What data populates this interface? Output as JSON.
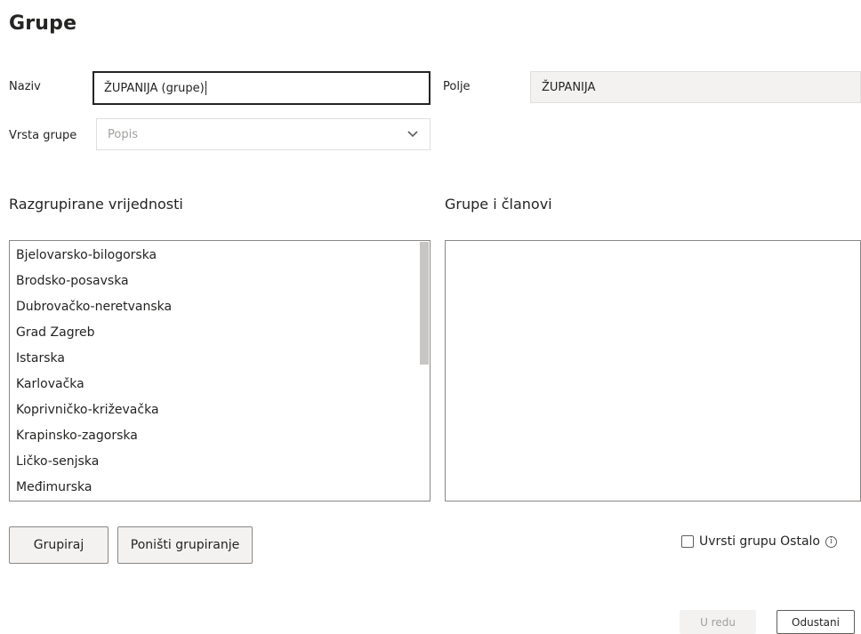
{
  "page": {
    "title": "Grupe"
  },
  "form": {
    "name_label": "Naziv",
    "name_value": "ŽUPANIJA (grupe)",
    "field_label": "Polje",
    "field_value": "ŽUPANIJA",
    "group_type_label": "Vrsta grupe",
    "group_type_value": "Popis"
  },
  "ungrouped": {
    "heading": "Razgrupirane vrijednosti",
    "items": [
      "Bjelovarsko-bilogorska",
      "Brodsko-posavska",
      "Dubrovačko-neretvanska",
      "Grad Zagreb",
      "Istarska",
      "Karlovačka",
      "Koprivničko-križevačka",
      "Krapinsko-zagorska",
      "Ličko-senjska",
      "Međimurska"
    ]
  },
  "groups": {
    "heading": "Grupe i članovi"
  },
  "actions": {
    "group_label": "Grupiraj",
    "ungroup_label": "Poništi grupiranje",
    "include_other_label": "Uvrsti grupu Ostalo",
    "info_glyph": "i"
  },
  "footer": {
    "ok_label": "U redu",
    "cancel_label": "Odustani"
  },
  "icons": {
    "chevron": "chevron-down-icon",
    "info": "info-icon"
  }
}
